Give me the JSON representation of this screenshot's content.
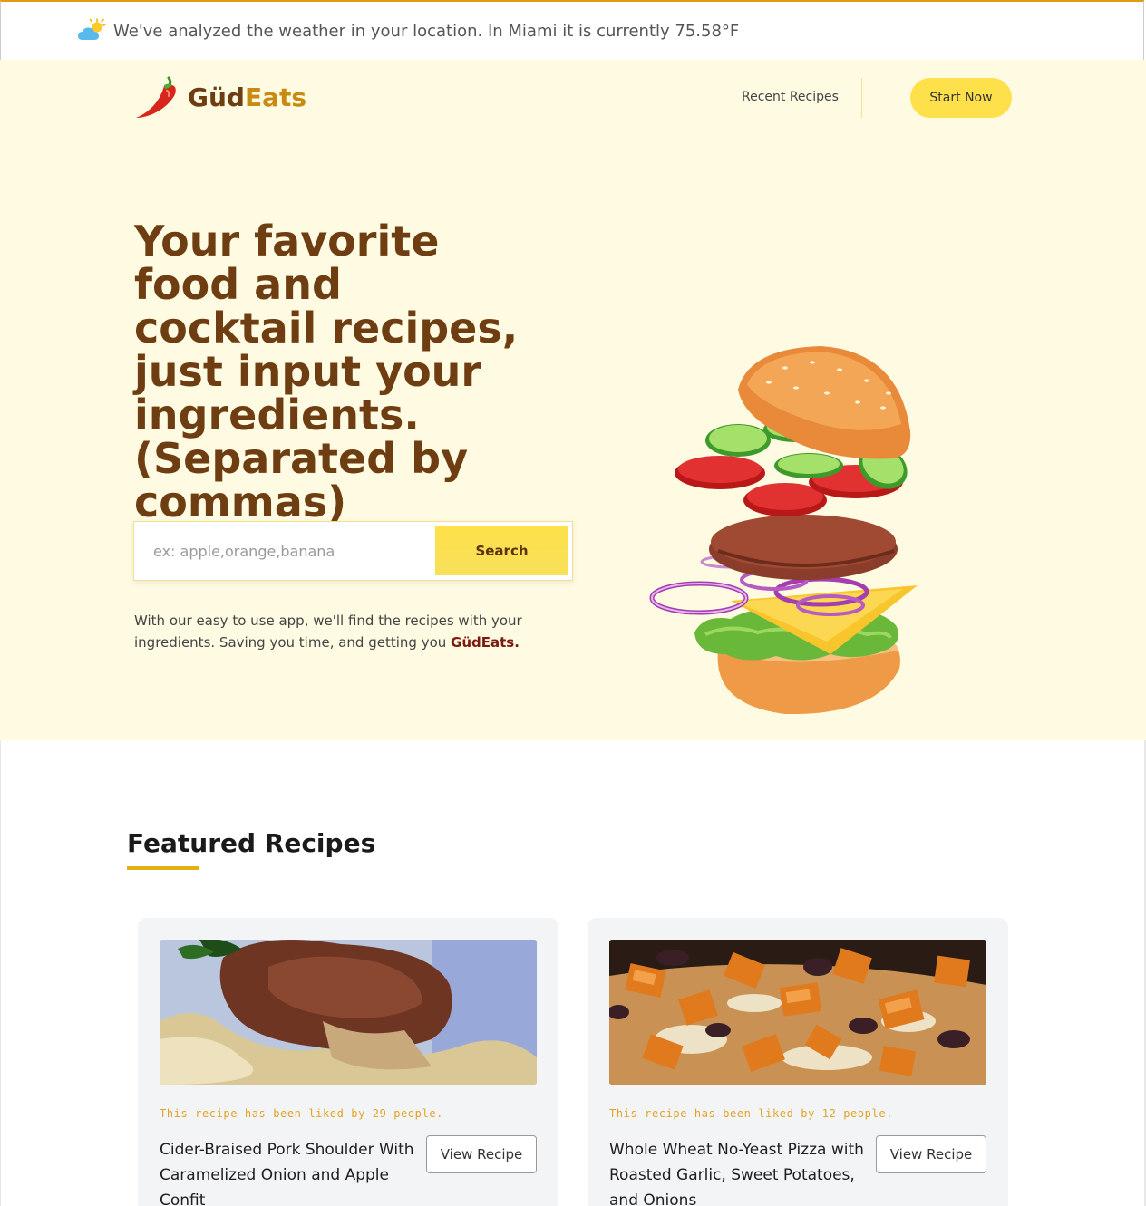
{
  "weather": {
    "icon": "partly-cloudy-icon",
    "message": "We've analyzed the weather in your location. In Miami it is currently 75.58°F"
  },
  "nav": {
    "brand_part1": "Güd",
    "brand_part2": "Eats",
    "logo_icon": "chili-pepper-icon",
    "recent_link": "Recent Recipes",
    "start_button": "Start Now"
  },
  "hero": {
    "title": "Your favorite food and cocktail recipes, just input your ingredients. (Separated by commas)",
    "search": {
      "placeholder": "ex: apple,orange,banana",
      "value": "",
      "button": "Search"
    },
    "description": "With our easy to use app, we'll find the recipes with your ingredients. Saving you time, and getting you ",
    "description_emphasis": "GüdEats.",
    "illustration": "burger-illustration"
  },
  "featured": {
    "title": "Featured Recipes",
    "cards": [
      {
        "likes": "This recipe has been liked by 29 people.",
        "title": "Cider-Braised Pork Shoulder With Caramelized Onion and Apple Confit",
        "button": "View Recipe",
        "image": "pork-shoulder-photo"
      },
      {
        "likes": "This recipe has been liked by 12 people.",
        "title": "Whole Wheat No-Yeast Pizza with Roasted Garlic, Sweet Potatoes, and Onions",
        "button": "View Recipe",
        "image": "sweet-potato-pizza-photo"
      }
    ]
  },
  "colors": {
    "accent_yellow": "#fde04a",
    "brand_brown": "#6e3e12",
    "brand_gold": "#c98a12",
    "hero_bg": "#fffbe3",
    "likes_text": "#e2a325",
    "underline": "#e2b214"
  }
}
